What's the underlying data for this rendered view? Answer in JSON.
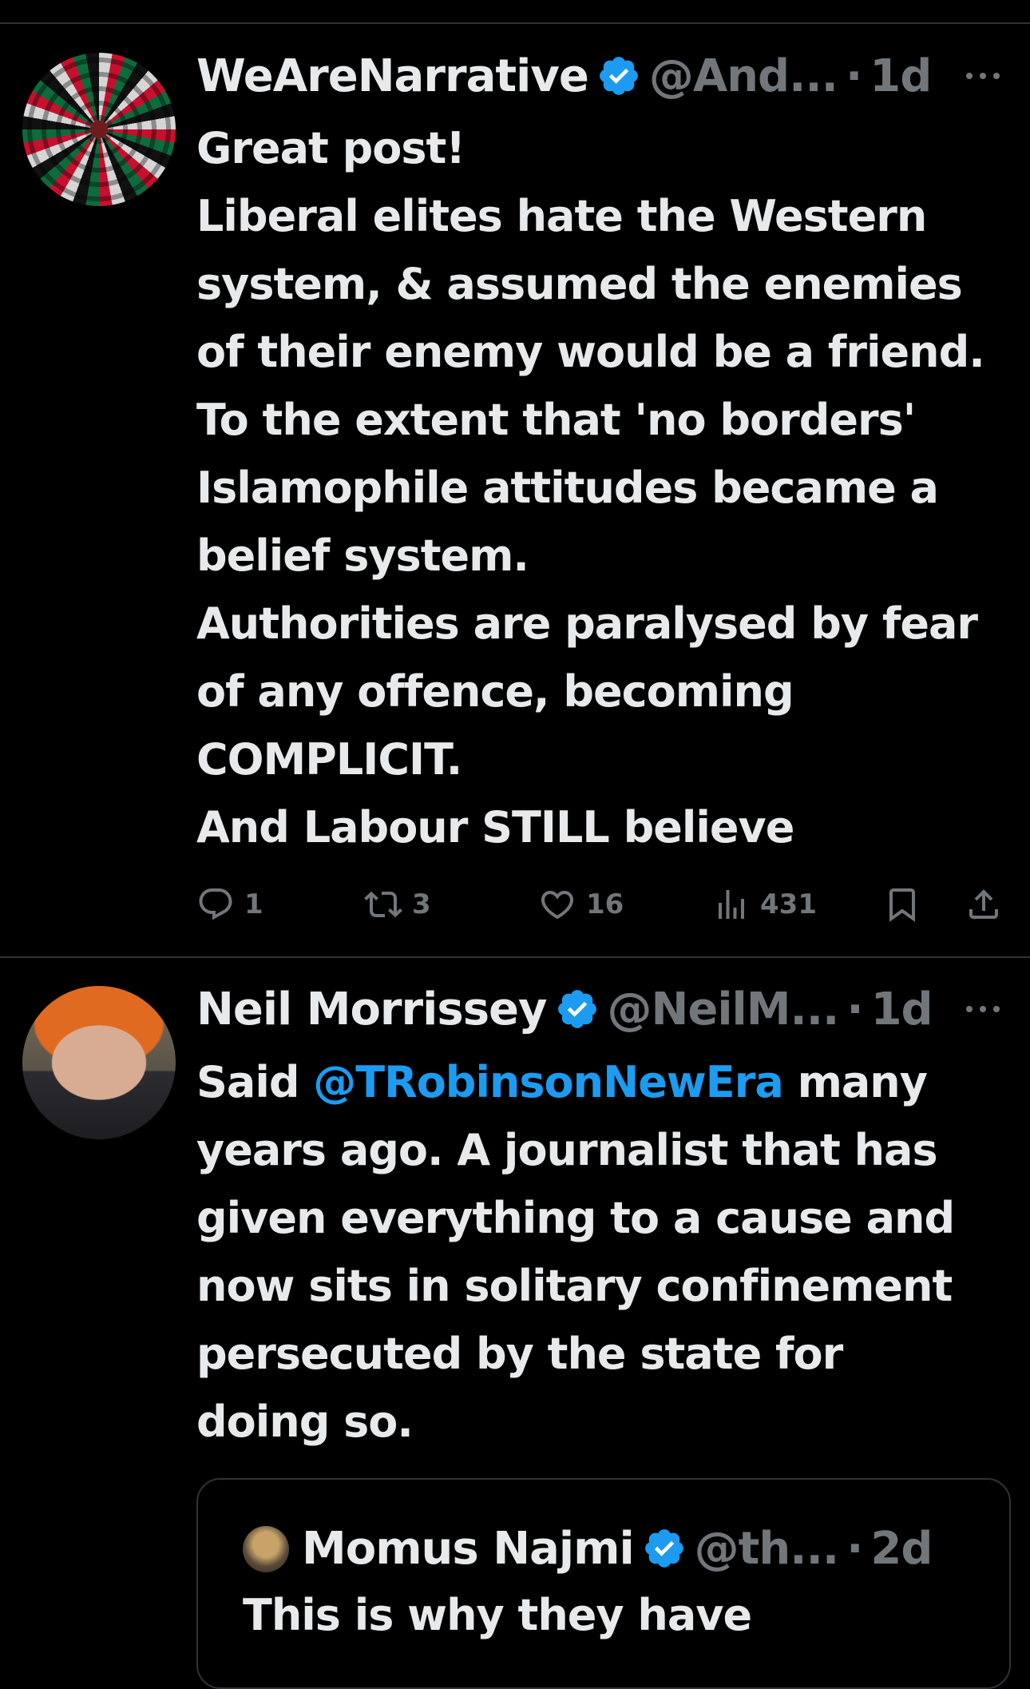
{
  "colors": {
    "background": "#000000",
    "text": "#e7e9ea",
    "muted": "#71767b",
    "link": "#1d9bf0",
    "verified": "#1d9bf0",
    "divider": "#2f3336"
  },
  "posts": [
    {
      "name": "WeAreNarrative",
      "handle": "@And...",
      "dot": "·",
      "time": "1d",
      "lines": [
        "Great post!",
        "Liberal elites hate the Western",
        "system, & assumed the enemies",
        "of their enemy would be a friend.",
        "To the extent that 'no borders'",
        "Islamophile attitudes became a",
        "belief system.",
        "Authorities are paralysed by fear",
        "of any offence, becoming",
        "COMPLICIT.",
        "And Labour STILL believe"
      ],
      "replies": "1",
      "reposts": "3",
      "likes": "16",
      "views": "431"
    },
    {
      "name": "Neil Morrissey",
      "handle": "@NeilM...",
      "dot": "·",
      "time": "1d",
      "line1_prefix": "Said ",
      "mention": "@TRobinsonNewEra",
      "line1_suffix": " many",
      "lines": [
        "years ago. A journalist that has",
        "given everything to a cause and",
        "now sits in solitary confinement",
        "persecuted by the state for",
        "doing so."
      ],
      "quote": {
        "name": "Momus Najmi",
        "handle": "@th...",
        "dot": "·",
        "time": "2d",
        "text": "This is why they have"
      }
    }
  ],
  "icons": [
    "verified-badge-icon",
    "more-icon",
    "reply-icon",
    "repost-icon",
    "like-icon",
    "views-icon",
    "bookmark-icon",
    "share-icon"
  ]
}
